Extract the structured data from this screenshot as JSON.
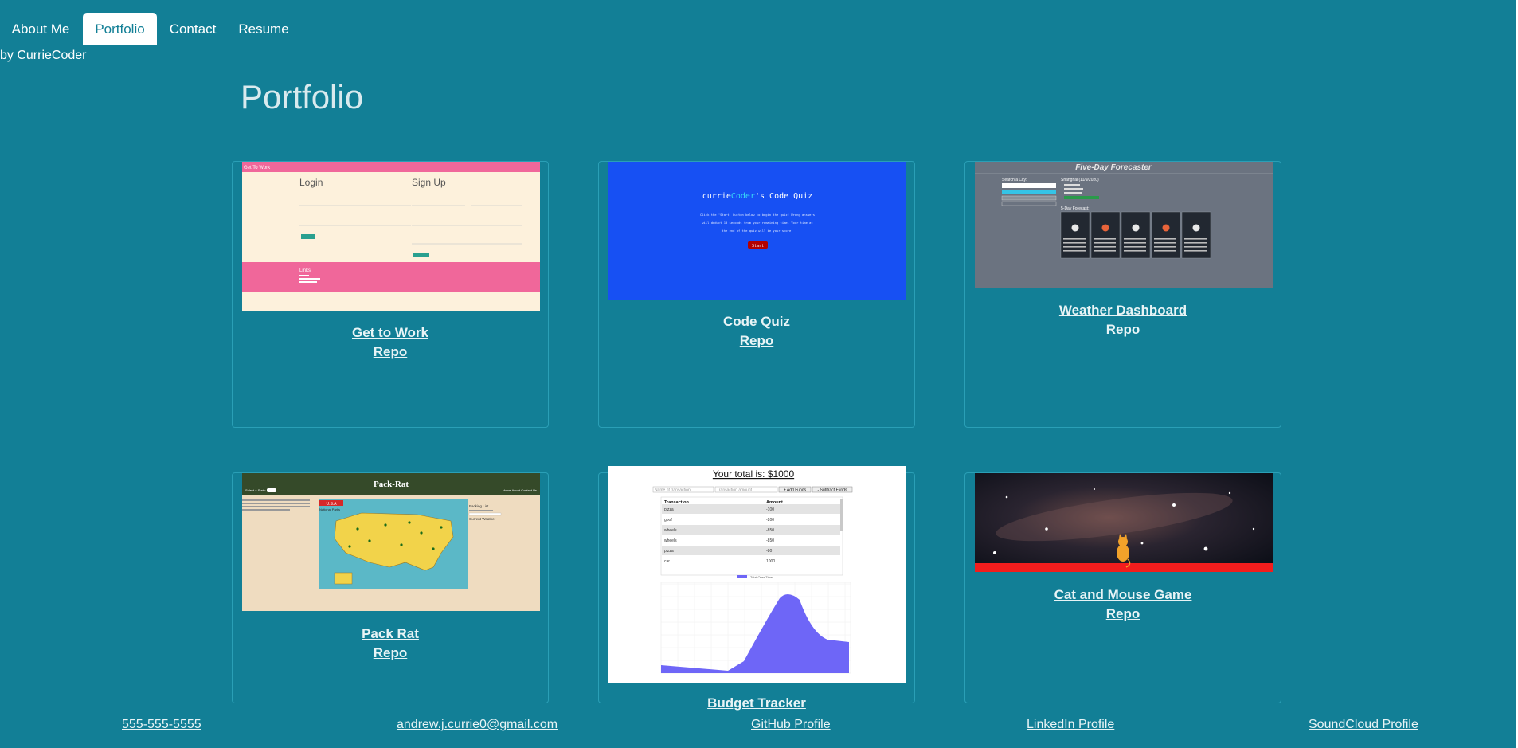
{
  "nav": {
    "tabs": [
      {
        "label": "About Me"
      },
      {
        "label": "Portfolio"
      },
      {
        "label": "Contact"
      },
      {
        "label": "Resume"
      }
    ]
  },
  "byline": "by CurrieCoder",
  "page_title": "Portfolio",
  "projects": [
    {
      "title": "Get to Work",
      "repo": "Repo"
    },
    {
      "title": "Code Quiz",
      "repo": "Repo"
    },
    {
      "title": "Weather Dashboard",
      "repo": "Repo"
    },
    {
      "title": "Pack Rat",
      "repo": "Repo"
    },
    {
      "title": "Budget Tracker",
      "repo": "Repo"
    },
    {
      "title": "Cat and Mouse Game",
      "repo": "Repo"
    }
  ],
  "thumbnails": {
    "get_to_work": {
      "header": "Get To Work",
      "login": "Login",
      "signup": "Sign Up",
      "links": "Links",
      "button": "Login"
    },
    "code_quiz": {
      "title_a": "currie",
      "title_b": "Coder",
      "title_c": "'s Code Quiz",
      "line1": "Click the 'Start' button below to begin the quiz! Wrong answers",
      "line2": "will deduct 10 seconds from your remaining time. Your time at",
      "line3": "the end of the quiz will be your score.",
      "start": "Start"
    },
    "weather": {
      "title": "Five-Day Forecaster",
      "search": "Search a City:",
      "city": "Shanghai (11/9/2020)",
      "forecast": "5-Day Forecast:"
    },
    "pack_rat": {
      "title": "Pack-Rat",
      "select": "Select a State:",
      "nav": "Home   About   Contact Us",
      "packing": "Packing List",
      "usa": "U.S.A",
      "parks": "National Parks",
      "current": "Current Weather"
    },
    "budget": {
      "total": "Your total is: $1000",
      "ph1": "Name of transaction",
      "ph2": "Transaction amount",
      "add": "+ Add Funds",
      "sub": "- Subtract Funds",
      "col1": "Transaction",
      "col2": "Amount",
      "rows": [
        [
          "pizza",
          "-100"
        ],
        [
          "goof",
          "-200"
        ],
        [
          "wheels",
          "-850"
        ],
        [
          "wheels",
          "-850"
        ],
        [
          "pizza",
          "-80"
        ],
        [
          "car",
          "1000"
        ]
      ],
      "legend": "Total Over Time"
    }
  },
  "footer": {
    "phone": "555-555-5555",
    "email": "andrew.j.currie0@gmail.com",
    "github": "GitHub Profile",
    "linkedin": "LinkedIn Profile",
    "soundcloud": "SoundCloud Profile"
  }
}
